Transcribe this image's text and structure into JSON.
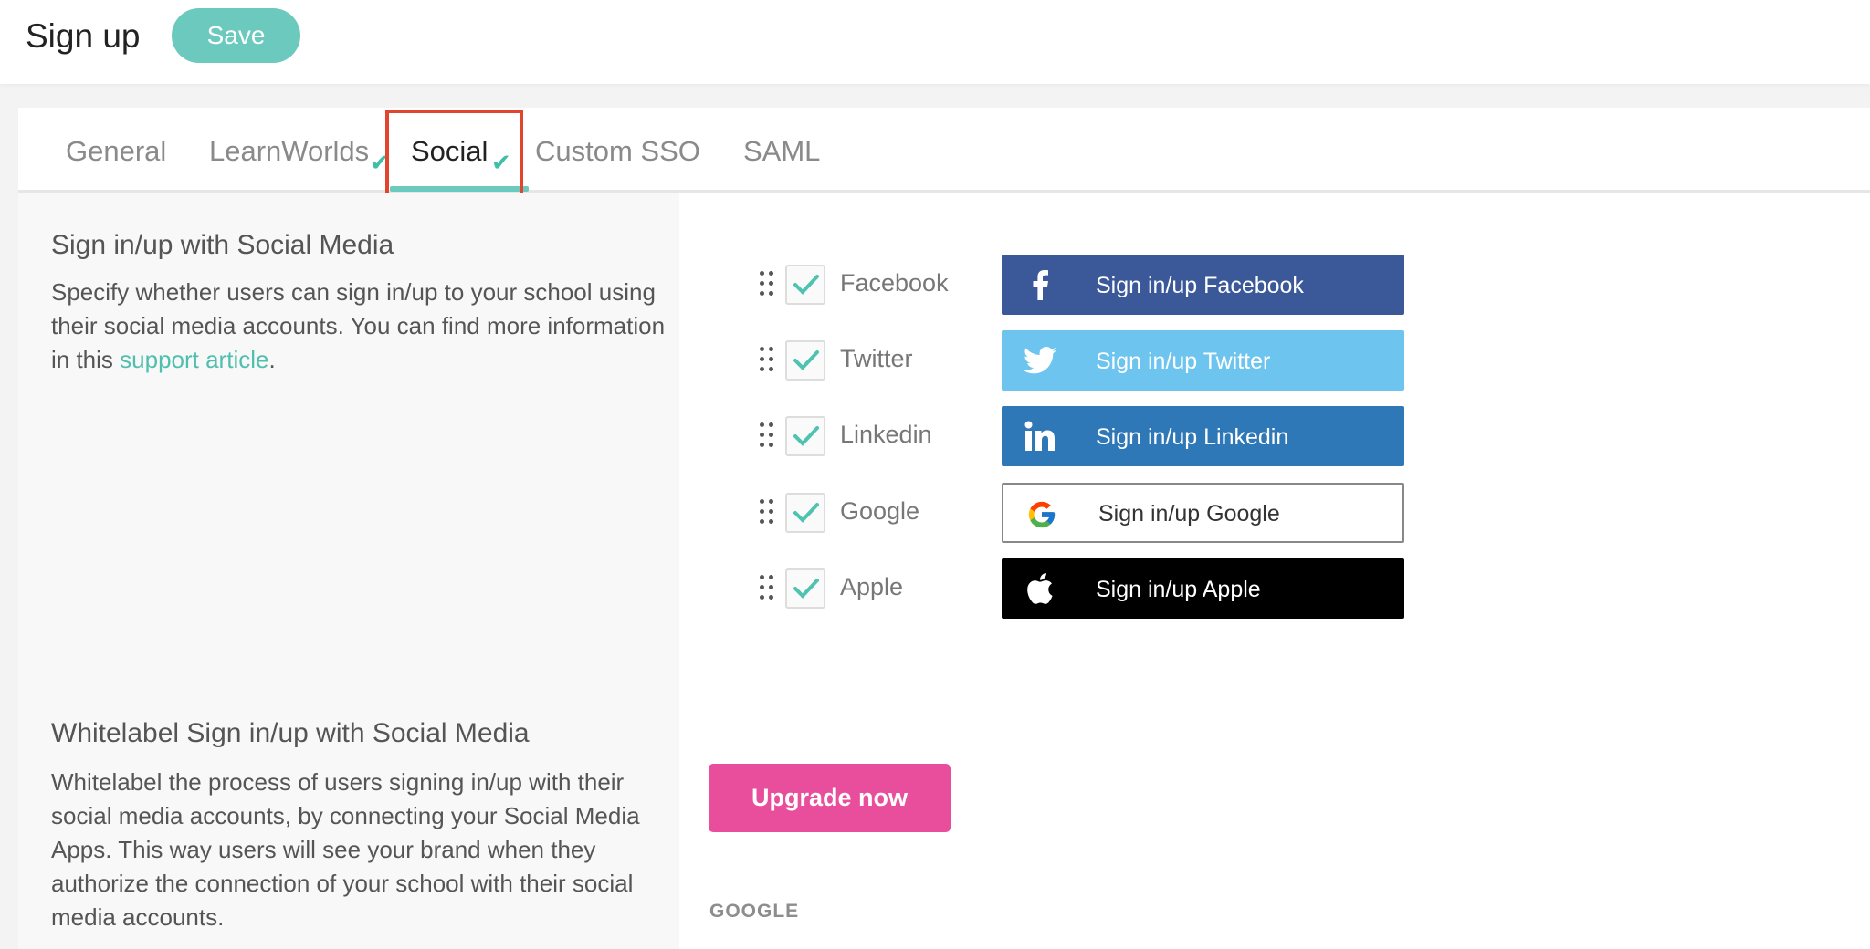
{
  "header": {
    "title": "Sign up",
    "save_label": "Save"
  },
  "tabs": [
    {
      "label": "General",
      "checked": false,
      "active": false
    },
    {
      "label": "LearnWorlds",
      "checked": true,
      "active": false
    },
    {
      "label": "Social",
      "checked": true,
      "active": true
    },
    {
      "label": "Custom SSO",
      "checked": false,
      "active": false
    },
    {
      "label": "SAML",
      "checked": false,
      "active": false
    }
  ],
  "social_section": {
    "title": "Sign in/up with Social Media",
    "desc_text": "Specify whether users can sign in/up to your school using their social media accounts. You can find more information in this",
    "link_text": "support article",
    "desc_end": "."
  },
  "providers": [
    {
      "label": "Facebook",
      "checked": true,
      "button_label": "Sign in/up Facebook",
      "color": "#3b5998",
      "icon": "facebook-icon"
    },
    {
      "label": "Twitter",
      "checked": true,
      "button_label": "Sign in/up Twitter",
      "color": "#6cc4ef",
      "icon": "twitter-icon"
    },
    {
      "label": "Linkedin",
      "checked": true,
      "button_label": "Sign in/up Linkedin",
      "color": "#2f78b7",
      "icon": "linkedin-icon"
    },
    {
      "label": "Google",
      "checked": true,
      "button_label": "Sign in/up Google",
      "color": "#ffffff",
      "icon": "google-icon"
    },
    {
      "label": "Apple",
      "checked": true,
      "button_label": "Sign in/up Apple",
      "color": "#000000",
      "icon": "apple-icon"
    }
  ],
  "whitelabel_section": {
    "title": "Whitelabel Sign in/up with Social Media",
    "desc": "Whitelabel the process of users signing in/up with their social media accounts, by connecting your Social Media Apps. This way users will see your brand when they authorize the connection of your school with their social media accounts.",
    "upgrade_label": "Upgrade now",
    "google_heading": "GOOGLE"
  },
  "colors": {
    "accent": "#6cc9bd",
    "link": "#4fbfae",
    "upgrade": "#e94e9d",
    "highlight": "#e1452d"
  }
}
